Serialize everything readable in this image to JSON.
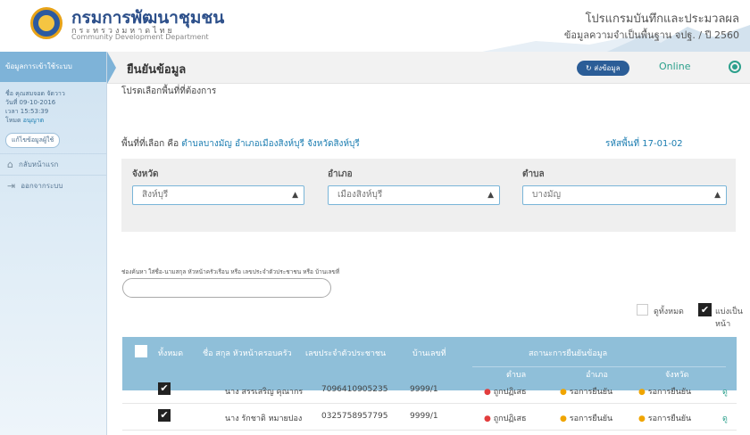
{
  "header": {
    "dept_name_th": "กรมการพัฒนาชุมชน",
    "ministry_th": "กระทรวงมหาดไทย",
    "dept_name_en": "Community Development Department",
    "program_title": "โปรแกรมบันทึกและประมวลผล",
    "program_subtitle": "ข้อมูลความจำเป็นพื้นฐาน จปฐ. / ปี 2560"
  },
  "sidebar": {
    "heading": "ข้อมูลการเข้าใช้ระบบ",
    "user_name": "ชื่อ คุณสมจอด จัดวาว",
    "date": "วันที่ 09-10-2016",
    "time": "เวลา 15:53:39",
    "role_prefix": "โหมด",
    "role": "อนุญาต",
    "edit_button": "แก้ไขข้อมูลผู้ใช้",
    "items": [
      {
        "label": "กลับหน้าแรก",
        "icon": "home-icon"
      },
      {
        "label": "ออกจากระบบ",
        "icon": "logout-icon"
      }
    ]
  },
  "main": {
    "title": "ยืนยันข้อมูล",
    "send_button": "ส่งข้อมูล",
    "status": "Online",
    "prompt": "โปรดเลือกพื้นที่ที่ต้องการ",
    "selected_prefix": "พื้นที่ที่เลือก คือ",
    "selected_area": "ตำบลบางมัญ อำเภอเมืองสิงห์บุรี จังหวัดสิงห์บุรี",
    "area_code": "รหัสพื้นที่ 17-01-02",
    "filters": {
      "province": {
        "label": "จังหวัด",
        "value": "สิงห์บุรี"
      },
      "district": {
        "label": "อำเภอ",
        "value": "เมืองสิงห์บุรี"
      },
      "subdistrict": {
        "label": "ตำบล",
        "value": "บางมัญ"
      }
    },
    "search_label": "ช่องค้นหา ใส่ชื่อ-นามสกุล หัวหน้าครัวเรือน หรือ เลขประจำตัวประชาชน หรือ บ้านเลขที่",
    "search_placeholder": "",
    "show_all_label": "ดูทั้งหมด",
    "paginate_label": "แบ่งเป็นหน้า"
  },
  "table": {
    "columns": {
      "select_all": "ทั้งหมด",
      "name": "ชื่อ สกุล หัวหน้าครอบครัว",
      "id": "เลขประจำตัวประชาชน",
      "house": "บ้านเลขที่",
      "status": "สถานะการยืนยันข้อมูล",
      "sub_tambon": "ตำบล",
      "sub_amphoe": "อำเภอ",
      "sub_province": "จังหวัด"
    },
    "rows": [
      {
        "checked": true,
        "name": "นาง   สรรเสริญ คุณากร",
        "id": "7096410905235",
        "house": "9999/1",
        "tambon": "ถูกปฏิเสธ",
        "amphoe": "รอการยืนยัน",
        "province": "รอการยืนยัน",
        "extra": "ดู"
      },
      {
        "checked": true,
        "name": "นาง   รักชาติ หมายปอง",
        "id": "0325758957795",
        "house": "9999/1",
        "tambon": "ถูกปฏิเสธ",
        "amphoe": "รอการยืนยัน",
        "province": "รอการยืนยัน",
        "extra": "ดู"
      }
    ]
  },
  "colors": {
    "accent": "#2b5d97",
    "header_row": "#8fbfd9",
    "online": "#2ca08c",
    "rejected": "#e23d3d",
    "pending": "#f0a500"
  }
}
